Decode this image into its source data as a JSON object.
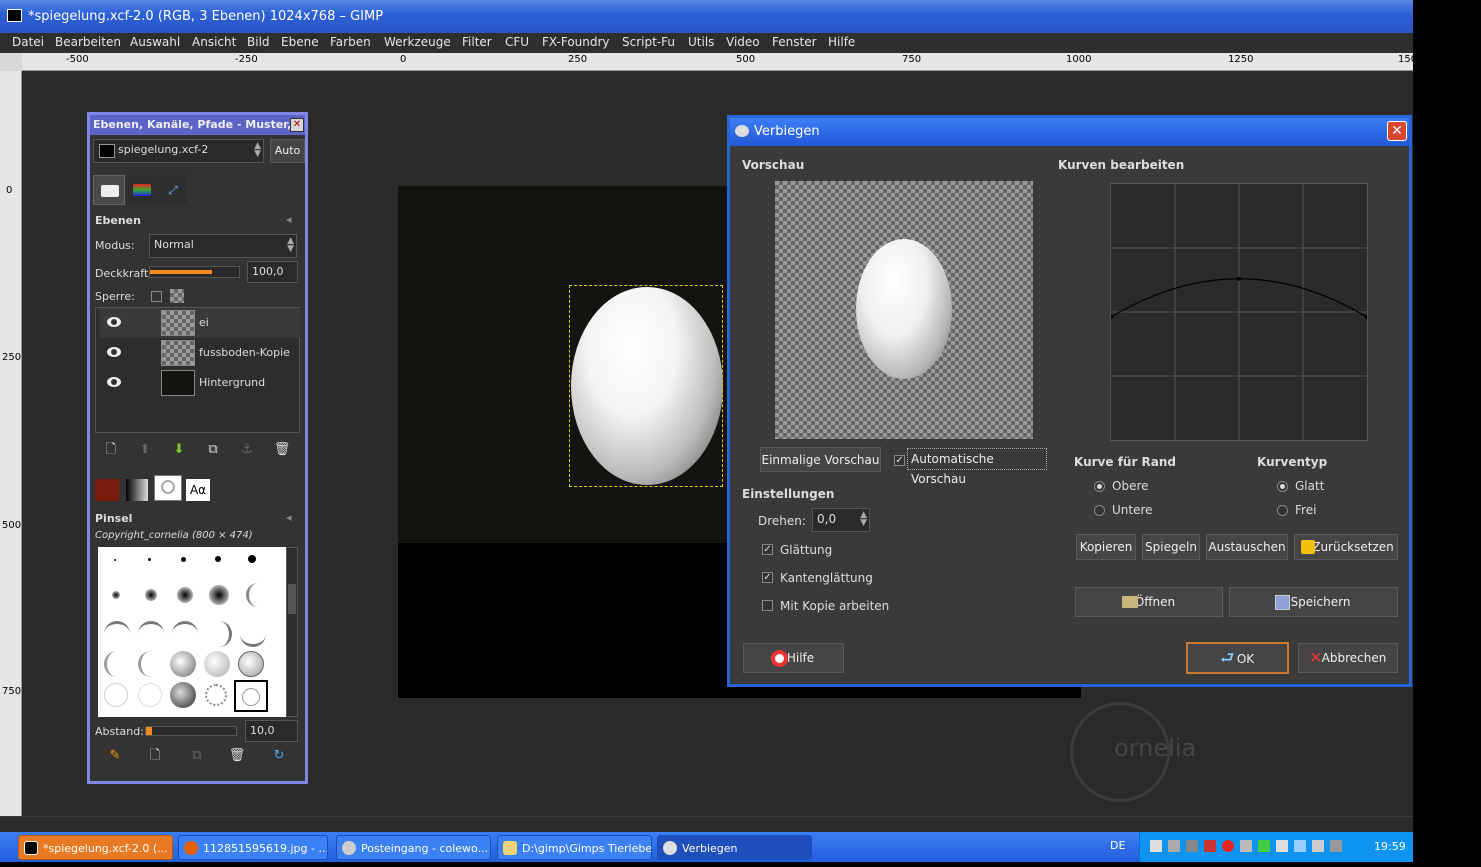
{
  "window": {
    "title": "*spiegelung.xcf-2.0 (RGB, 3 Ebenen) 1024x768 – GIMP"
  },
  "menu": [
    "Datei",
    "Bearbeiten",
    "Auswahl",
    "Ansicht",
    "Bild",
    "Ebene",
    "Farben",
    "Werkzeuge",
    "Filter",
    "CFU",
    "FX-Foundry",
    "Script-Fu",
    "Utils",
    "Video",
    "Fenster",
    "Hilfe"
  ],
  "ruler": {
    "top_labels": [
      "-500",
      "-250",
      "0",
      "250",
      "500",
      "750",
      "1000",
      "1250",
      "150"
    ],
    "left_labels": [
      "0",
      "250",
      "500",
      "750"
    ]
  },
  "dock": {
    "title": "Ebenen, Kanäle, Pfade - Muster, F...",
    "image_select": "spiegelung.xcf-2",
    "auto_label": "Auto",
    "layers_heading": "Ebenen",
    "mode_label": "Modus:",
    "mode_value": "Normal",
    "opacity_label": "Deckkraft:",
    "opacity_value": "100,0",
    "lock_label": "Sperre:",
    "layers": [
      {
        "name": "ei"
      },
      {
        "name": "fussboden-Kopie"
      },
      {
        "name": "Hintergrund"
      }
    ],
    "brush_heading": "Pinsel",
    "brush_name": "Copyright_cornelia (800 × 474)",
    "spacing_label": "Abstand:",
    "spacing_value": "10,0",
    "text_tab_label": "Aα"
  },
  "dialog": {
    "title": "Verbiegen",
    "preview_heading": "Vorschau",
    "curves_heading": "Kurven bearbeiten",
    "once_preview_btn": "Einmalige Vorschau",
    "auto_preview_label": "Automatische Vorschau",
    "settings_heading": "Einstellungen",
    "rotate_label": "Drehen:",
    "rotate_value": "0,0",
    "smoothing_label": "Glättung",
    "antialias_label": "Kantenglättung",
    "copy_label": "Mit Kopie arbeiten",
    "border_curve_heading": "Kurve für Rand",
    "upper_label": "Obere",
    "lower_label": "Untere",
    "curve_type_heading": "Kurventyp",
    "smooth_label": "Glatt",
    "free_label": "Frei",
    "copy_btn": "Kopieren",
    "mirror_btn": "Spiegeln",
    "swap_btn": "Austauschen",
    "reset_btn": "Zurücksetzen",
    "open_btn": "Öffnen",
    "save_btn": "Speichern",
    "help_btn": "Hilfe",
    "ok_btn": "OK",
    "cancel_btn": "Abbrechen",
    "curve_points": [
      [
        0,
        0.52
      ],
      [
        0.5,
        0.37
      ],
      [
        1,
        0.52
      ]
    ]
  },
  "canvas": {
    "watermark": "ornelia"
  },
  "taskbar": {
    "tasks": [
      {
        "label": "*spiegelung.xcf-2.0 (..."
      },
      {
        "label": "112851595619.jpg - ..."
      },
      {
        "label": "Posteingang - colewo..."
      },
      {
        "label": "D:\\gimp\\Gimps Tierleben"
      },
      {
        "label": "Verbiegen"
      }
    ],
    "lang": "DE",
    "clock": "19:59"
  },
  "colors": {
    "accent_blue": "#2863d8",
    "dock_border": "#7f86e6",
    "selection": "#d8d200",
    "taskbar_orange": "#e87a24"
  }
}
